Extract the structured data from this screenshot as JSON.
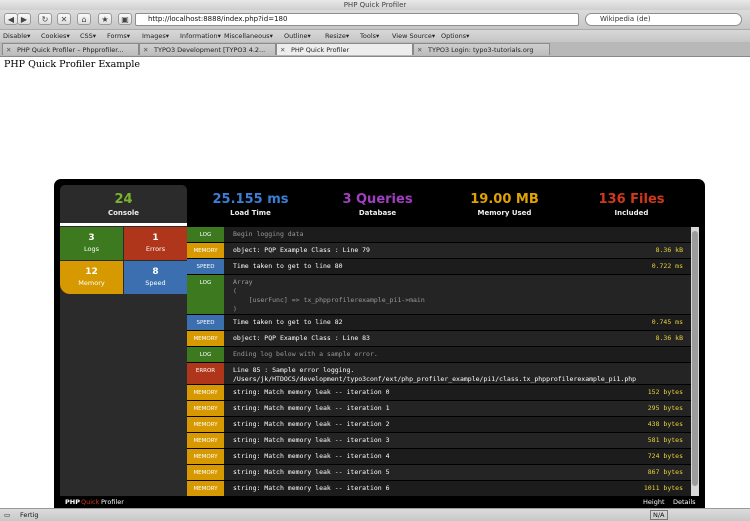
{
  "window": {
    "title": "PHP Quick Profiler"
  },
  "nav": {
    "back": "◀",
    "forward": "▶",
    "reload": "↻",
    "stop": "✕",
    "home": "⌂",
    "bookmark": "★",
    "screen": "▣",
    "url": "http://localhost:8888/index.php?id=180",
    "search": "Wikipedia (de)"
  },
  "devbar": {
    "items": [
      "Disable▾",
      "Cookies▾",
      "CSS▾",
      "Forms▾",
      "Images▾",
      "Information▾",
      "Miscellaneous▾",
      "Outline▾",
      "Resize▾",
      "Tools▾",
      "View Source▾",
      "Options▾"
    ]
  },
  "tabs": [
    {
      "label": "PHP Quick Profiler – Phpprofiler..."
    },
    {
      "label": "TYPO3 Development [TYPO3 4.2..."
    },
    {
      "label": "PHP Quick Profiler"
    },
    {
      "label": "TYPO3 Login: typo3-tutorials.org"
    }
  ],
  "page": {
    "heading": "PHP Quick Profiler Example"
  },
  "profiler": {
    "stats": [
      {
        "value": "24",
        "label": "Console",
        "color": "#7ab32e"
      },
      {
        "value": "25.155 ms",
        "label": "Load Time",
        "color": "#3b7fd6"
      },
      {
        "value": "3 Queries",
        "label": "Database",
        "color": "#a23ec2"
      },
      {
        "value": "19.00 MB",
        "label": "Memory Used",
        "color": "#e0a200"
      },
      {
        "value": "136 Files",
        "label": "Included",
        "color": "#d2381c"
      }
    ],
    "counters": [
      {
        "value": "3",
        "label": "Logs",
        "color": "#3d7a1f"
      },
      {
        "value": "1",
        "label": "Errors",
        "color": "#b0361b"
      },
      {
        "value": "12",
        "label": "Memory",
        "color": "#d69a00"
      },
      {
        "value": "8",
        "label": "Speed",
        "color": "#3b6fb0"
      }
    ],
    "rows": [
      {
        "type": "LOG",
        "cls": "t-log",
        "msg": "Begin logging data",
        "val": "",
        "dim": true
      },
      {
        "type": "MEMORY",
        "cls": "t-memory",
        "msg": "object: PQP Example Class : Line 79",
        "val": "8.36 kB"
      },
      {
        "type": "SPEED",
        "cls": "t-speed",
        "msg": "Time taken to get to line 80",
        "val": "0.722 ms"
      },
      {
        "type": "LOG",
        "cls": "t-log",
        "msg": "Array\n(\n    [userFunc] => tx_phpprofilerexample_pi1->main\n)",
        "val": "",
        "dim": true,
        "tall": 3
      },
      {
        "type": "SPEED",
        "cls": "t-speed",
        "msg": "Time taken to get to line 82",
        "val": "0.745 ms"
      },
      {
        "type": "MEMORY",
        "cls": "t-memory",
        "msg": "object: PQP Example Class : Line 83",
        "val": "8.36 kB"
      },
      {
        "type": "LOG",
        "cls": "t-log",
        "msg": "Ending log below with a sample error.",
        "val": "",
        "dim": true
      },
      {
        "type": "ERROR",
        "cls": "t-error",
        "msg": "Line 85 : Sample error logging.\n/Users/jk/HTDOCS/development/typo3conf/ext/php_profiler_example/pi1/class.tx_phpprofilerexample_pi1.php",
        "val": "",
        "tall": 2
      },
      {
        "type": "MEMORY",
        "cls": "t-memory",
        "msg": "string: Match memory leak -- iteration 0",
        "val": "152 bytes"
      },
      {
        "type": "MEMORY",
        "cls": "t-memory",
        "msg": "string: Match memory leak -- iteration 1",
        "val": "295 bytes"
      },
      {
        "type": "MEMORY",
        "cls": "t-memory",
        "msg": "string: Match memory leak -- iteration 2",
        "val": "438 bytes"
      },
      {
        "type": "MEMORY",
        "cls": "t-memory",
        "msg": "string: Match memory leak -- iteration 3",
        "val": "581 bytes"
      },
      {
        "type": "MEMORY",
        "cls": "t-memory",
        "msg": "string: Match memory leak -- iteration 4",
        "val": "724 bytes"
      },
      {
        "type": "MEMORY",
        "cls": "t-memory",
        "msg": "string: Match memory leak -- iteration 5",
        "val": "867 bytes"
      },
      {
        "type": "MEMORY",
        "cls": "t-memory",
        "msg": "string: Match memory leak -- iteration 6",
        "val": "1011 bytes"
      }
    ],
    "footer": {
      "brand_php": "PHP",
      "brand_quick": "Quick",
      "brand_profiler": "Profiler",
      "height_link": "Height",
      "details_link": "Details"
    }
  },
  "status": {
    "text": "Fertig",
    "na": "N/A"
  }
}
